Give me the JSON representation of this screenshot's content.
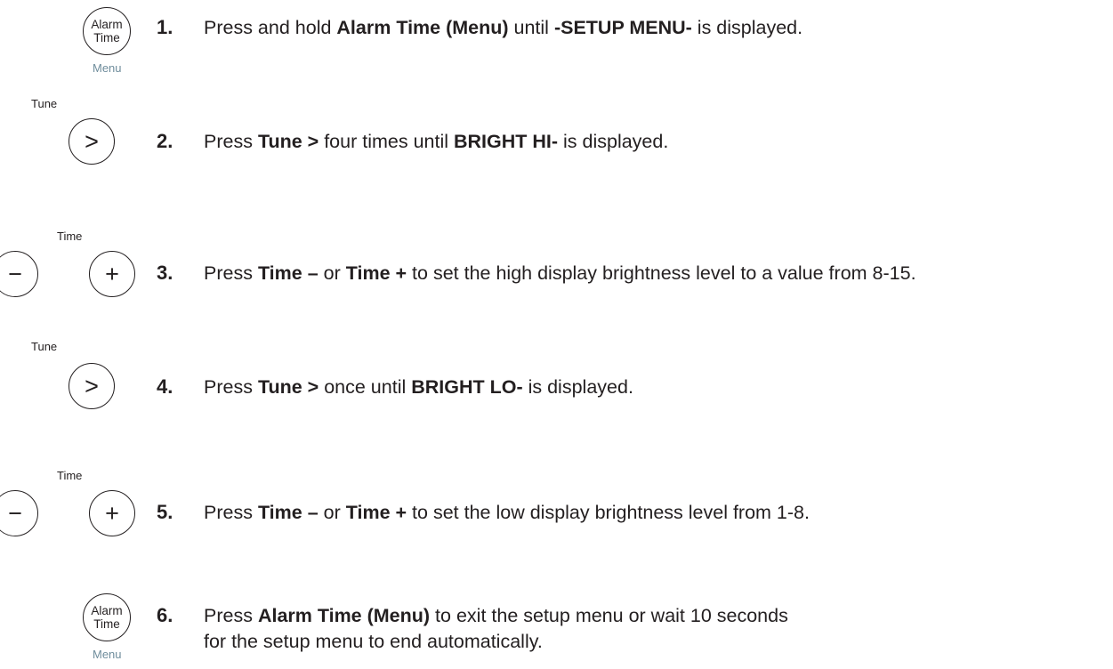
{
  "icons": {
    "alarm_line1": "Alarm",
    "alarm_line2": "Time",
    "menu_label": "Menu",
    "tune_label": "Tune",
    "time_label": "Time",
    "next_glyph": ">",
    "minus_glyph": "−",
    "plus_glyph": "+"
  },
  "steps": [
    {
      "number": "1.",
      "parts": [
        "Press and hold ",
        "Alarm Time (Menu)",
        " until ",
        "-SETUP MENU-",
        " is displayed."
      ]
    },
    {
      "number": "2.",
      "parts": [
        "Press ",
        "Tune >",
        " four times until ",
        "BRIGHT HI-",
        " is displayed."
      ]
    },
    {
      "number": "3.",
      "parts": [
        "Press ",
        "Time –",
        " or ",
        "Time +",
        " to set the high display brightness level to a value from 8-15."
      ]
    },
    {
      "number": "4.",
      "parts": [
        "Press ",
        "Tune >",
        " once until ",
        "BRIGHT LO-",
        " is displayed."
      ]
    },
    {
      "number": "5.",
      "parts": [
        "Press ",
        "Time –",
        " or ",
        "Time +",
        " to set the low display brightness level from 1-8."
      ]
    },
    {
      "number": "6.",
      "parts": [
        "Press ",
        "Alarm Time (Menu)",
        " to exit the setup menu or wait 10 seconds for the setup menu to end automatically."
      ]
    }
  ]
}
